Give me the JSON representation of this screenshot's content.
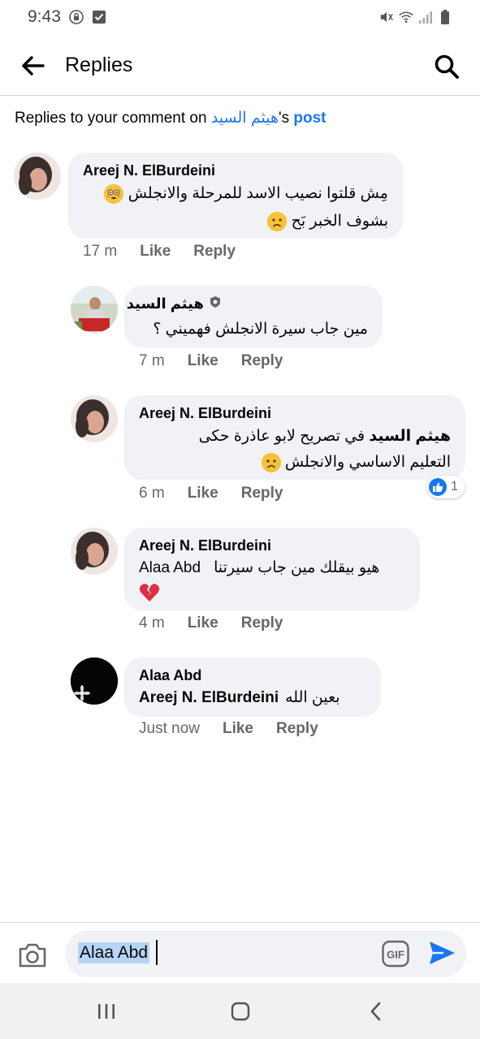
{
  "status_bar": {
    "time": "9:43"
  },
  "header": {
    "title": "Replies"
  },
  "subheader": {
    "prefix": "Replies to your comment on ",
    "post_author": "هيثم السيد",
    "possessive": "'s ",
    "post_link": "post"
  },
  "comments": [
    {
      "name": "Areej N. ElBurdeini",
      "lines": [
        "مِش قلتوا نصيب الاسد للمرحلة والانجلش",
        "بشوف الخبر بَح"
      ],
      "time": "17 m",
      "like": "Like",
      "reply": "Reply"
    },
    {
      "name": "هيثم السيد",
      "lines": [
        "مين جاب سيرة الانجلش فهميني ؟"
      ],
      "time": "7 m",
      "like": "Like",
      "reply": "Reply"
    },
    {
      "name": "Areej N. ElBurdeini",
      "mention": "هيثم السيد",
      "lines": [
        "في تصريح  لابو عاذرة حكى",
        "التعليم الاساسي والانجلش"
      ],
      "time": "6 m",
      "like": "Like",
      "reply": "Reply",
      "reaction_count": "1"
    },
    {
      "name": "Areej N. ElBurdeini",
      "mention": "Alaa Abd",
      "lines": [
        "هيو بيقلك مين جاب سيرتنا"
      ],
      "time": "4 m",
      "like": "Like",
      "reply": "Reply"
    },
    {
      "name": "Alaa Abd",
      "mention": "Areej N. ElBurdeini",
      "lines": [
        "بعين الله"
      ],
      "time": "Just now",
      "like": "Like",
      "reply": "Reply"
    }
  ],
  "composer": {
    "value": "Alaa Abd",
    "gif_label": "GIF"
  },
  "icons": {
    "back": "arrow-left-icon",
    "search": "search-icon",
    "camera": "camera-icon",
    "send": "send-icon",
    "gif": "gif-icon"
  },
  "colors": {
    "accent": "#1877f2",
    "bubble": "#f0f2f5",
    "meta": "#65676b"
  }
}
